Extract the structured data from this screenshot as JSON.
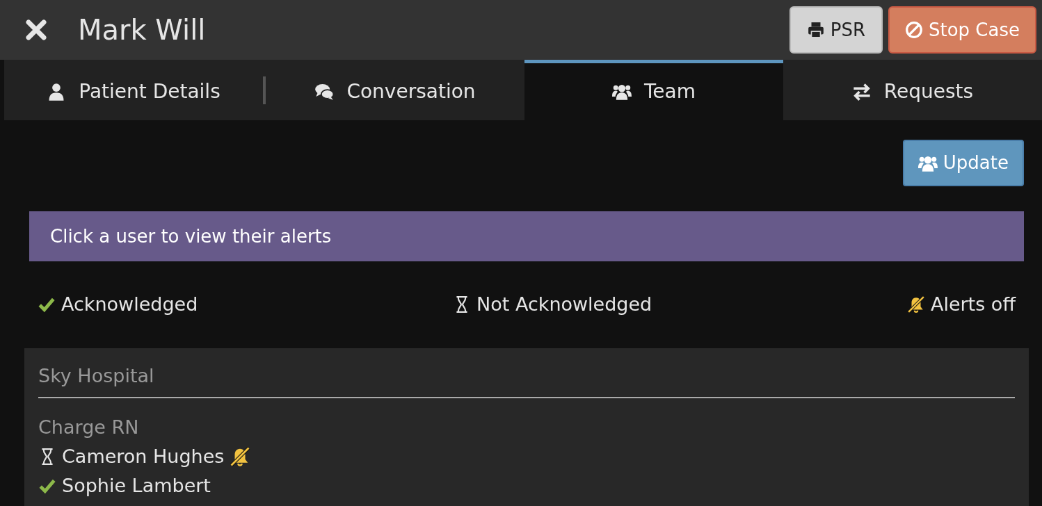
{
  "header": {
    "title": "Mark Will",
    "buttons": [
      {
        "label": "PSR",
        "kind": "print"
      },
      {
        "label": "Stop Case",
        "kind": "stop"
      }
    ]
  },
  "tabs": [
    {
      "label": "Patient Details",
      "selected": false
    },
    {
      "label": "Conversation",
      "selected": false
    },
    {
      "label": "Team",
      "selected": true
    },
    {
      "label": "Requests",
      "selected": false
    }
  ],
  "update_button": "Update",
  "info_alert": "Click a user to view their alerts",
  "legend": [
    {
      "kind": "acknowledged",
      "label": "Acknowledged"
    },
    {
      "kind": "pending",
      "label": "Not Acknowledged"
    },
    {
      "kind": "alerts_off",
      "label": "Alerts off"
    }
  ],
  "team": {
    "site": "Sky Hospital",
    "roles": [
      {
        "role": "Charge RN",
        "members": [
          {
            "name": "Cameron Hughes",
            "acknowledged": false,
            "alerts_off": true
          },
          {
            "name": "Sophie Lambert",
            "acknowledged": true,
            "alerts_off": false
          }
        ]
      }
    ]
  }
}
